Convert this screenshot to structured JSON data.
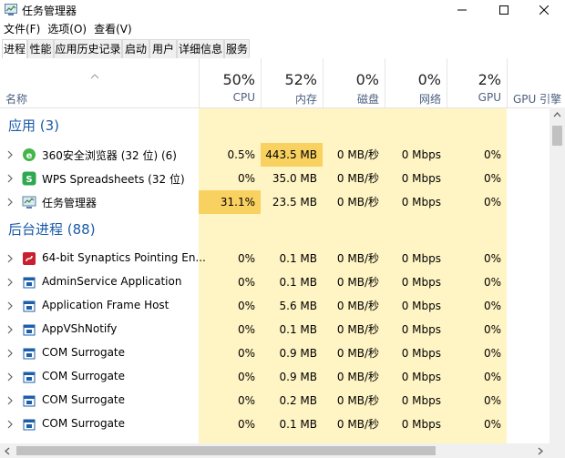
{
  "window": {
    "title": "任务管理器",
    "icon": "task-manager-icon"
  },
  "menu": [
    "文件(F)",
    "选项(O)",
    "查看(V)"
  ],
  "tabs": [
    "进程",
    "性能",
    "应用历史记录",
    "启动",
    "用户",
    "详细信息",
    "服务"
  ],
  "active_tab": "进程",
  "columns": {
    "name_label": "名称",
    "items": [
      {
        "key": "cpu",
        "percent": "50%",
        "label": "CPU"
      },
      {
        "key": "mem",
        "percent": "52%",
        "label": "内存"
      },
      {
        "key": "disk",
        "percent": "0%",
        "label": "磁盘"
      },
      {
        "key": "net",
        "percent": "0%",
        "label": "网络"
      },
      {
        "key": "gpu",
        "percent": "2%",
        "label": "GPU"
      },
      {
        "key": "gpu_engine",
        "percent": "",
        "label": "GPU 引擎"
      }
    ]
  },
  "groups": [
    {
      "title": "应用 (3)",
      "rows": [
        {
          "name": "360安全浏览器 (32 位) (6)",
          "icon": "360-browser-icon",
          "cpu": "0.5%",
          "mem": "443.5 MB",
          "disk": "0 MB/秒",
          "net": "0 Mbps",
          "gpu": "0%",
          "cpu_heat": "low",
          "mem_heat": "high"
        },
        {
          "name": "WPS Spreadsheets (32 位)",
          "icon": "wps-spreadsheets-icon",
          "cpu": "0%",
          "mem": "35.0 MB",
          "disk": "0 MB/秒",
          "net": "0 Mbps",
          "gpu": "0%",
          "cpu_heat": "none",
          "mem_heat": "low"
        },
        {
          "name": "任务管理器",
          "icon": "task-manager-icon",
          "cpu": "31.1%",
          "mem": "23.5 MB",
          "disk": "0 MB/秒",
          "net": "0 Mbps",
          "gpu": "0%",
          "cpu_heat": "high",
          "mem_heat": "low"
        }
      ]
    },
    {
      "title": "后台进程 (88)",
      "rows": [
        {
          "name": "64-bit Synaptics Pointing En...",
          "icon": "synaptics-icon",
          "cpu": "0%",
          "mem": "0.1 MB",
          "disk": "0 MB/秒",
          "net": "0 Mbps",
          "gpu": "0%",
          "cpu_heat": "none",
          "mem_heat": "low"
        },
        {
          "name": "AdminService Application",
          "icon": "service-window-icon",
          "cpu": "0%",
          "mem": "0.1 MB",
          "disk": "0 MB/秒",
          "net": "0 Mbps",
          "gpu": "0%",
          "cpu_heat": "none",
          "mem_heat": "low"
        },
        {
          "name": "Application Frame Host",
          "icon": "service-window-icon",
          "cpu": "0%",
          "mem": "5.6 MB",
          "disk": "0 MB/秒",
          "net": "0 Mbps",
          "gpu": "0%",
          "cpu_heat": "none",
          "mem_heat": "low"
        },
        {
          "name": "AppVShNotify",
          "icon": "service-window-icon",
          "cpu": "0%",
          "mem": "0.1 MB",
          "disk": "0 MB/秒",
          "net": "0 Mbps",
          "gpu": "0%",
          "cpu_heat": "none",
          "mem_heat": "low"
        },
        {
          "name": "COM Surrogate",
          "icon": "service-window-icon",
          "cpu": "0%",
          "mem": "0.9 MB",
          "disk": "0 MB/秒",
          "net": "0 Mbps",
          "gpu": "0%",
          "cpu_heat": "none",
          "mem_heat": "low"
        },
        {
          "name": "COM Surrogate",
          "icon": "service-window-icon",
          "cpu": "0%",
          "mem": "0.9 MB",
          "disk": "0 MB/秒",
          "net": "0 Mbps",
          "gpu": "0%",
          "cpu_heat": "none",
          "mem_heat": "low"
        },
        {
          "name": "COM Surrogate",
          "icon": "service-window-icon",
          "cpu": "0%",
          "mem": "0.2 MB",
          "disk": "0 MB/秒",
          "net": "0 Mbps",
          "gpu": "0%",
          "cpu_heat": "none",
          "mem_heat": "low"
        },
        {
          "name": "COM Surrogate",
          "icon": "service-window-icon",
          "cpu": "0%",
          "mem": "0.1 MB",
          "disk": "0 MB/秒",
          "net": "0 Mbps",
          "gpu": "0%",
          "cpu_heat": "none",
          "mem_heat": "low"
        }
      ]
    }
  ],
  "colors": {
    "heat_none": "#fff4c4",
    "heat_low": "#fff4c4",
    "heat_high": "#f9e396",
    "heat_peak": "#f9d160",
    "group_title": "#1a5aa8",
    "header_label": "#4d6082"
  }
}
